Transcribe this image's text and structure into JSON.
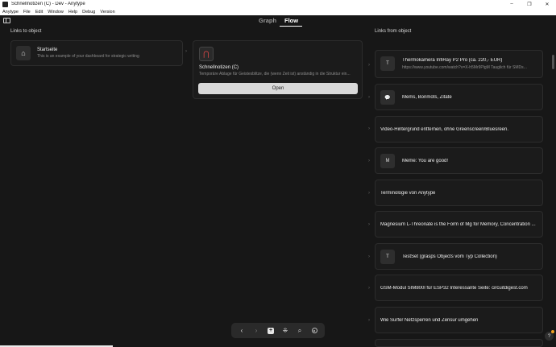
{
  "window": {
    "title": "Schnellnotizen (C) - Dev - Anytype",
    "controls": [
      "–",
      "❐",
      "✕"
    ]
  },
  "menu": [
    "Anytype",
    "File",
    "Edit",
    "Window",
    "Help",
    "Debug",
    "Version"
  ],
  "tabs": {
    "graph": "Graph",
    "flow": "Flow",
    "active": "Flow"
  },
  "left": {
    "header": "Links to object",
    "card": {
      "title": "Startseite",
      "description": "This is an example of your dashboard for strategic writing",
      "icon": "house-icon"
    }
  },
  "center": {
    "title": "Schnellnotizen (C)",
    "description": "Temporäre Ablage für Geistesblitze, die (wenn Zeit ist) anständig in die Struktur ein...",
    "icon": "magnet-icon",
    "open_label": "Open"
  },
  "right": {
    "header": "Links from object",
    "items": [
      {
        "title": "Thermokamera InfiRay P2 Pro (ca. 220,- EUR)",
        "description": "https://www.youtube.com/watch?v=X-h5Mr9PlgM Tauglich für SMDs...",
        "icon_letter": "T"
      },
      {
        "title": "Mems, Bonmots, Zitate",
        "description": "",
        "icon_letter": "💬"
      },
      {
        "title": "Video-Hintergrund entfernen, ohne Greenscreen/Bluesreen.",
        "description": "",
        "icon_letter": ""
      },
      {
        "title": "Meme: You are good!",
        "description": "",
        "icon_letter": "M"
      },
      {
        "title": "Terminologie von Anytype",
        "description": "",
        "icon_letter": ""
      },
      {
        "title": "Magnesium L-Threonate is the Form of Mg for Memory, Concentration ...",
        "description": "",
        "icon_letter": ""
      },
      {
        "title": "TestSet (grasps Objects vom Typ Collection)",
        "description": "",
        "icon_letter": "T"
      },
      {
        "title": "GSM-Modul SIM800l für ESP32 Interessante Seite: circuitdigest.com",
        "description": "",
        "icon_letter": ""
      },
      {
        "title": "Wie Surfer Netzsperren und Zensur umgehen",
        "description": "",
        "icon_letter": ""
      }
    ]
  },
  "toolbar": {
    "back": "‹",
    "forward": "›",
    "add": "+",
    "graph": "⁜",
    "search": "⌕"
  },
  "help": "?"
}
